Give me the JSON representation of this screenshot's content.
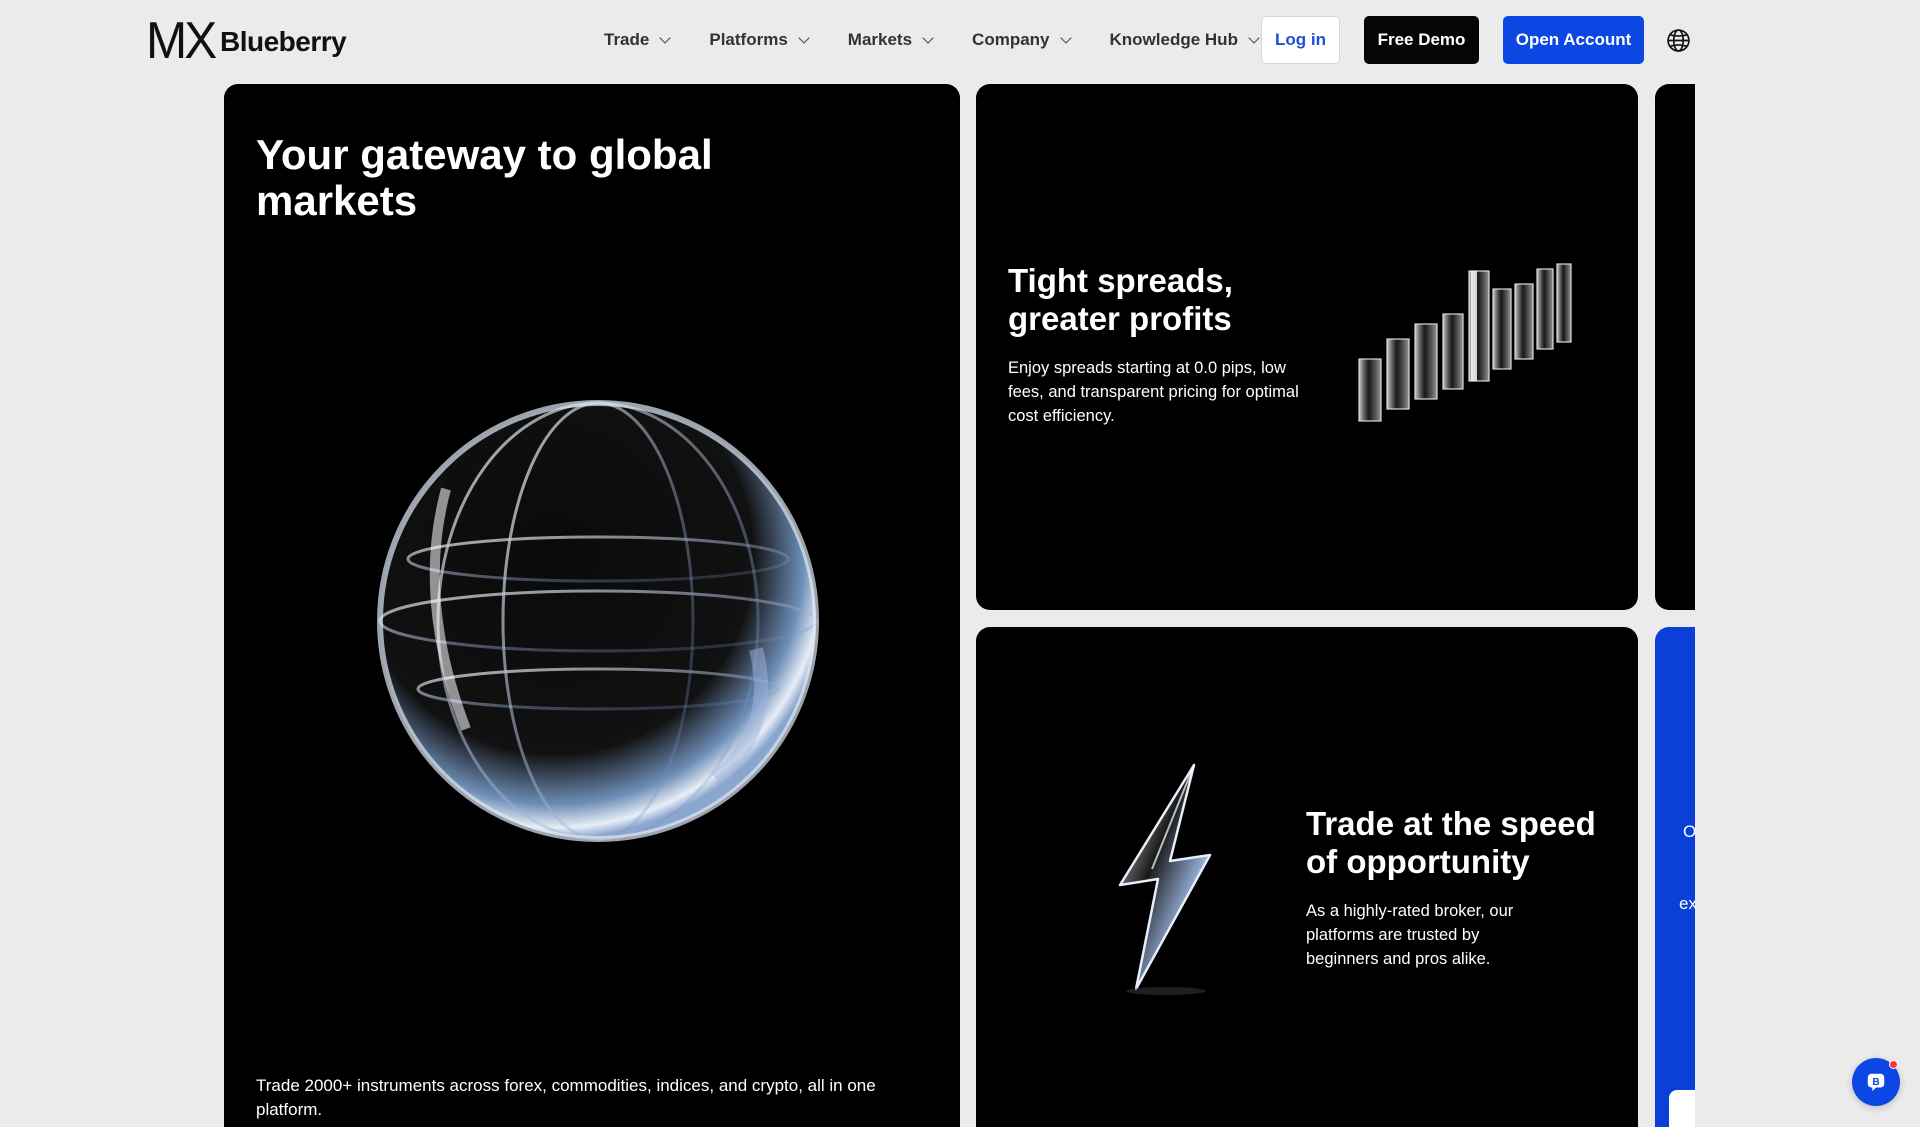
{
  "brand": {
    "mx": "MX",
    "name": "Blueberry"
  },
  "nav": {
    "items": [
      {
        "label": "Trade"
      },
      {
        "label": "Platforms"
      },
      {
        "label": "Markets"
      },
      {
        "label": "Company"
      },
      {
        "label": "Knowledge Hub"
      }
    ],
    "login_label": "Log in",
    "demo_label": "Free Demo",
    "open_label": "Open Account",
    "language_icon": "globe-icon"
  },
  "cards": {
    "main": {
      "title": "Your gateway to global markets",
      "description": "Trade 2000+ instruments across forex, commodities, indices, and crypto, all in one platform.",
      "image": "glass-globe"
    },
    "spreads": {
      "title": "Tight spreads, greater profits",
      "description": "Enjoy spreads starting at 0.0 pips, low fees, and transparent pricing for optimal cost efficiency.",
      "image": "glass-bar-chart"
    },
    "speed": {
      "title": "Trade at the speed of opportunity",
      "description": "As a highly-rated broker, our platforms are trusted by beginners and pros alike.",
      "image": "glass-lightning-bolt"
    },
    "peek": {
      "line1": "O",
      "line2": "ex"
    }
  },
  "chat": {
    "icon": "chat-icon",
    "badge_color": "#f23a3a"
  },
  "colors": {
    "accent": "#0d47e3",
    "card": "#000000",
    "background": "#ebebeb"
  }
}
